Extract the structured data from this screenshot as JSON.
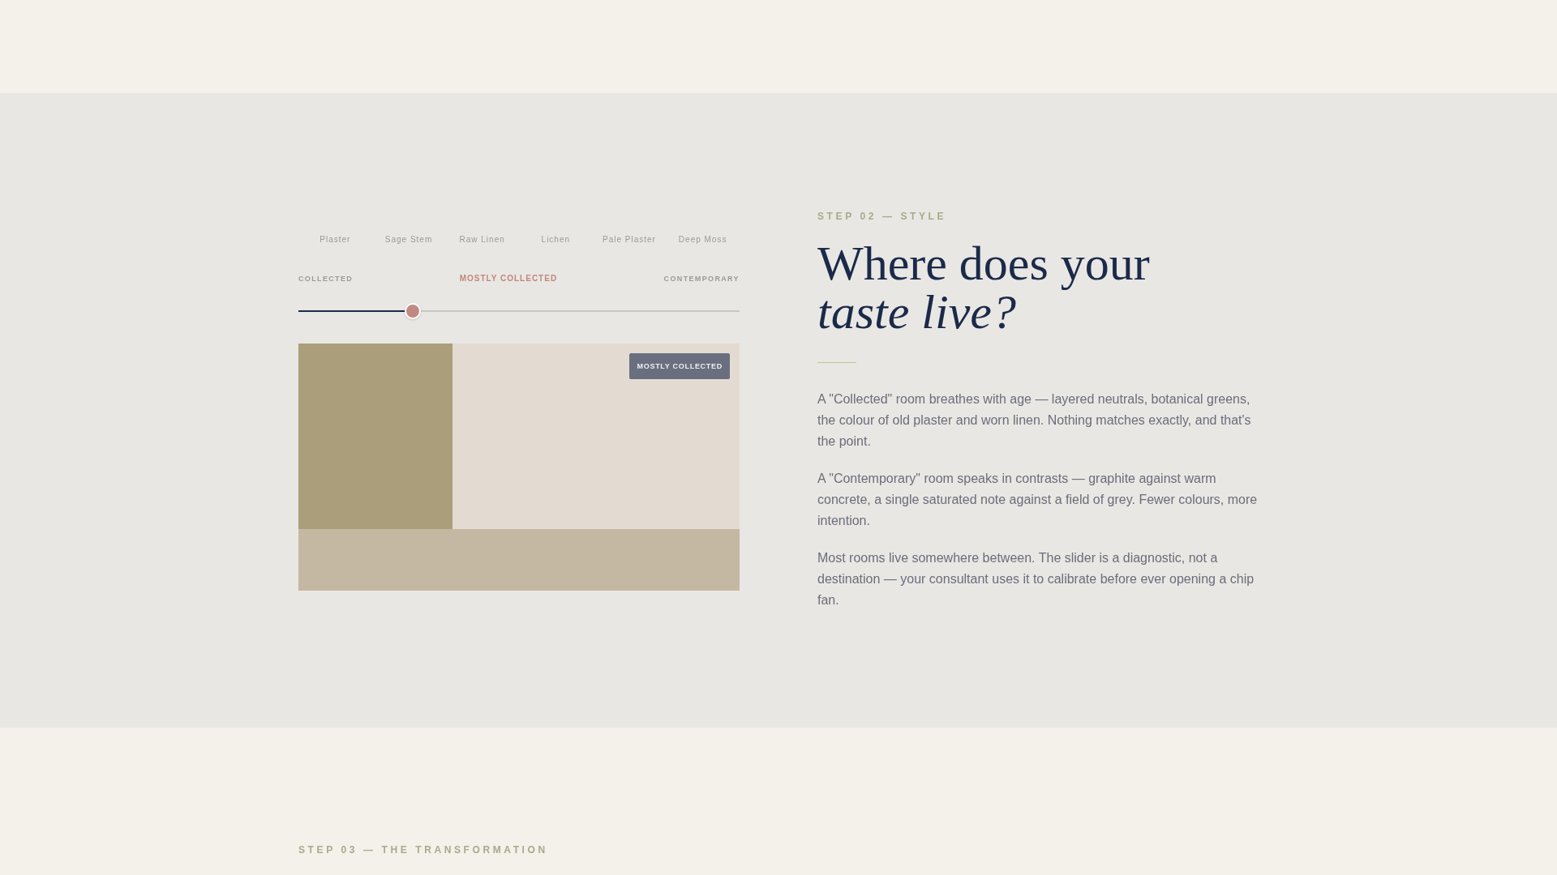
{
  "palette": {
    "names": [
      "Plaster",
      "Sage Stem",
      "Raw Linen",
      "Lichen",
      "Pale Plaster",
      "Deep Moss"
    ]
  },
  "style_slider": {
    "min_label": "COLLECTED",
    "value_label": "MOSTLY COLLECTED",
    "max_label": "CONTEMPORARY",
    "level": 0.25
  },
  "preview": {
    "badge": "MOSTLY COLLECTED",
    "blocks": [
      {
        "color": "#ab9e7b"
      },
      {
        "color": "#e3dbd2"
      },
      {
        "color": "#c4b8a2"
      }
    ]
  },
  "step_label": "STEP 02 — STYLE",
  "heading": {
    "lines": [
      "Where does your",
      "*taste live?*"
    ]
  },
  "paragraphs": [
    "A \"Collected\" room breathes with age — layered neutrals, botanical greens, the colour of old plaster and worn linen. Nothing matches exactly, and that's the point.",
    "A \"Contemporary\" room speaks in contrasts — graphite against warm concrete, a single saturated note against a field of grey. Fewer colours, more intention.",
    "Most rooms live somewhere between. The slider is a diagnostic, not a destination — your consultant uses it to calibrate before ever opening a chip fan."
  ],
  "next_step": {
    "label": "STEP 03 — THE TRANSFORMATION"
  }
}
